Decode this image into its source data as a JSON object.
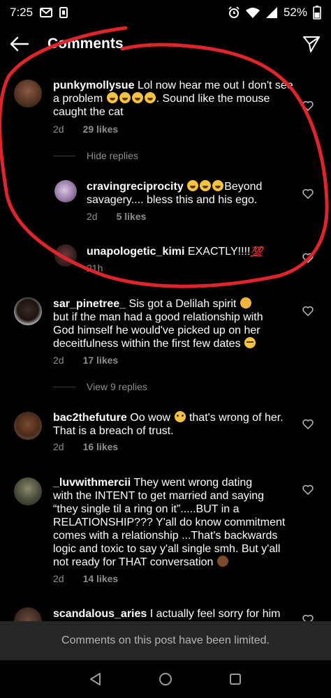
{
  "status_bar": {
    "time": "7:25",
    "battery": "52%"
  },
  "header": {
    "title": "Comments"
  },
  "comments": [
    {
      "username": "punkymollysue",
      "text_lines": [
        "Lol now hear me out I don't see",
        "a problem",
        ". Sound like the mouse",
        "caught the cat"
      ],
      "age": "2d",
      "likes": "29 likes"
    },
    {
      "hide_replies": "Hide replies"
    },
    {
      "username": "cravingreciprocity",
      "text_lines": [
        "Beyond",
        "savagery.... bless this and his ego."
      ],
      "age": "2d",
      "likes": "5 likes"
    },
    {
      "username": "unapologetic_kimi",
      "text_lines": [
        "EXACTLY!!!!"
      ],
      "emoji_text": "💯",
      "age": "21h"
    },
    {
      "username": "sar_pinetree_",
      "text_lines": [
        "Sis got a Delilah spirit",
        "but if the man had a good relationship with",
        "God himself he would've picked up on her",
        "deceitfulness within the first few dates"
      ],
      "age": "2d",
      "likes": "17 likes"
    },
    {
      "view_replies": "View 9 replies"
    },
    {
      "username": "bac2thefuture",
      "text_lines": [
        "Oo wow",
        "that's wrong of her.",
        "That is a breach of trust."
      ],
      "age": "2d",
      "likes": "16 likes"
    },
    {
      "username": "_luvwithmercii",
      "text_lines": [
        "They went wrong dating",
        "with the INTENT to get married and saying",
        "“they single til a ring on it”.....BUT in a",
        "RELATIONSHIP??? Y'all do know commitment",
        "comes with a relationship ...That's backwards",
        "logic and toxic to say y'all single smh. But y'all",
        "not ready for THAT conversation"
      ],
      "age": "2d",
      "likes": "14 likes"
    },
    {
      "username": "scandalous_aries",
      "text_lines": [
        "I actually feel sorry for him"
      ]
    }
  ],
  "limited_notice": "Comments on this post have been limited.",
  "colors": {
    "background": "#000000",
    "annotation": "#e0242b",
    "secondary_text": "#8e8e8e",
    "bar": "#262626"
  }
}
